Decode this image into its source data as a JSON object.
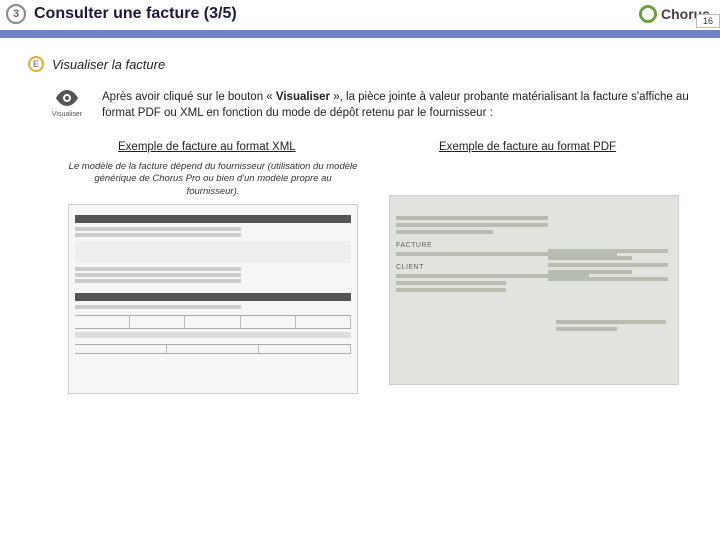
{
  "header": {
    "step": "3",
    "title": "Consulter une facture (3/5)",
    "logo_text": "Chorus",
    "page_number": "16"
  },
  "sub": {
    "letter": "E",
    "title": "Visualiser la facture"
  },
  "intro": {
    "eye_label": "Visualiser",
    "text_a": "Après avoir cliqué sur le bouton « ",
    "text_bold": "Visualiser",
    "text_b": " », la pièce jointe à valeur probante matérialisant la facture s'affiche au format PDF ou XML en fonction du mode de dépôt retenu par le fournisseur :"
  },
  "examples": {
    "xml_link": "Exemple de facture au format XML",
    "xml_note": "Le modèle de la facture dépend du fournisseur (utilisation du modèle générique de Chorus Pro ou bien d'un modèle propre au fournisseur).",
    "pdf_link": "Exemple de facture au format PDF",
    "pdf_facture": "FACTURE",
    "pdf_client": "CLIENT"
  }
}
